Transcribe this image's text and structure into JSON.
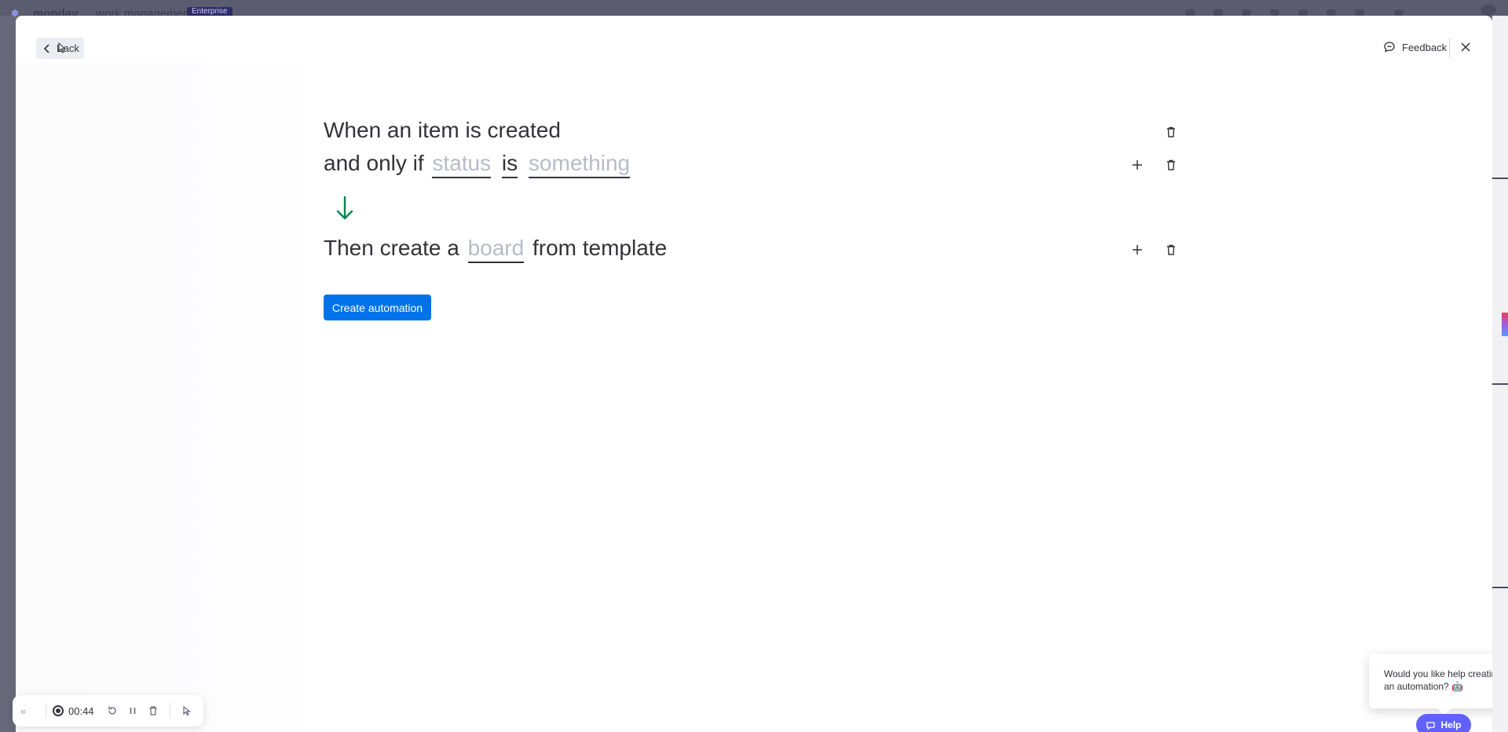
{
  "background": {
    "brand": "monday",
    "brand_sub": "work management",
    "plan_badge": "Enterprise"
  },
  "header": {
    "back_label": "Back",
    "feedback_label": "Feedback"
  },
  "recipe": {
    "trigger": "When an item is created",
    "condition_prefix": "and only if",
    "condition_field": "status",
    "condition_is": "is",
    "condition_value": "something",
    "action_prefix": "Then create a",
    "action_field": "board",
    "action_suffix": "from template"
  },
  "create_button_label": "Create automation",
  "recorder": {
    "time": "00:44"
  },
  "help_tooltip": {
    "text": "Would you like help creating an automation? 🤖"
  },
  "help_button_label": "Help",
  "colors": {
    "primary": "#0073ea",
    "arrow": "#00854d",
    "help": "#6161ff",
    "placeholder": "#b8bcc8"
  },
  "icons": {
    "trash": "trash-icon",
    "plus": "plus-icon",
    "arrow": "arrow-down-icon",
    "feedback": "feedback-icon",
    "close": "close-icon"
  }
}
